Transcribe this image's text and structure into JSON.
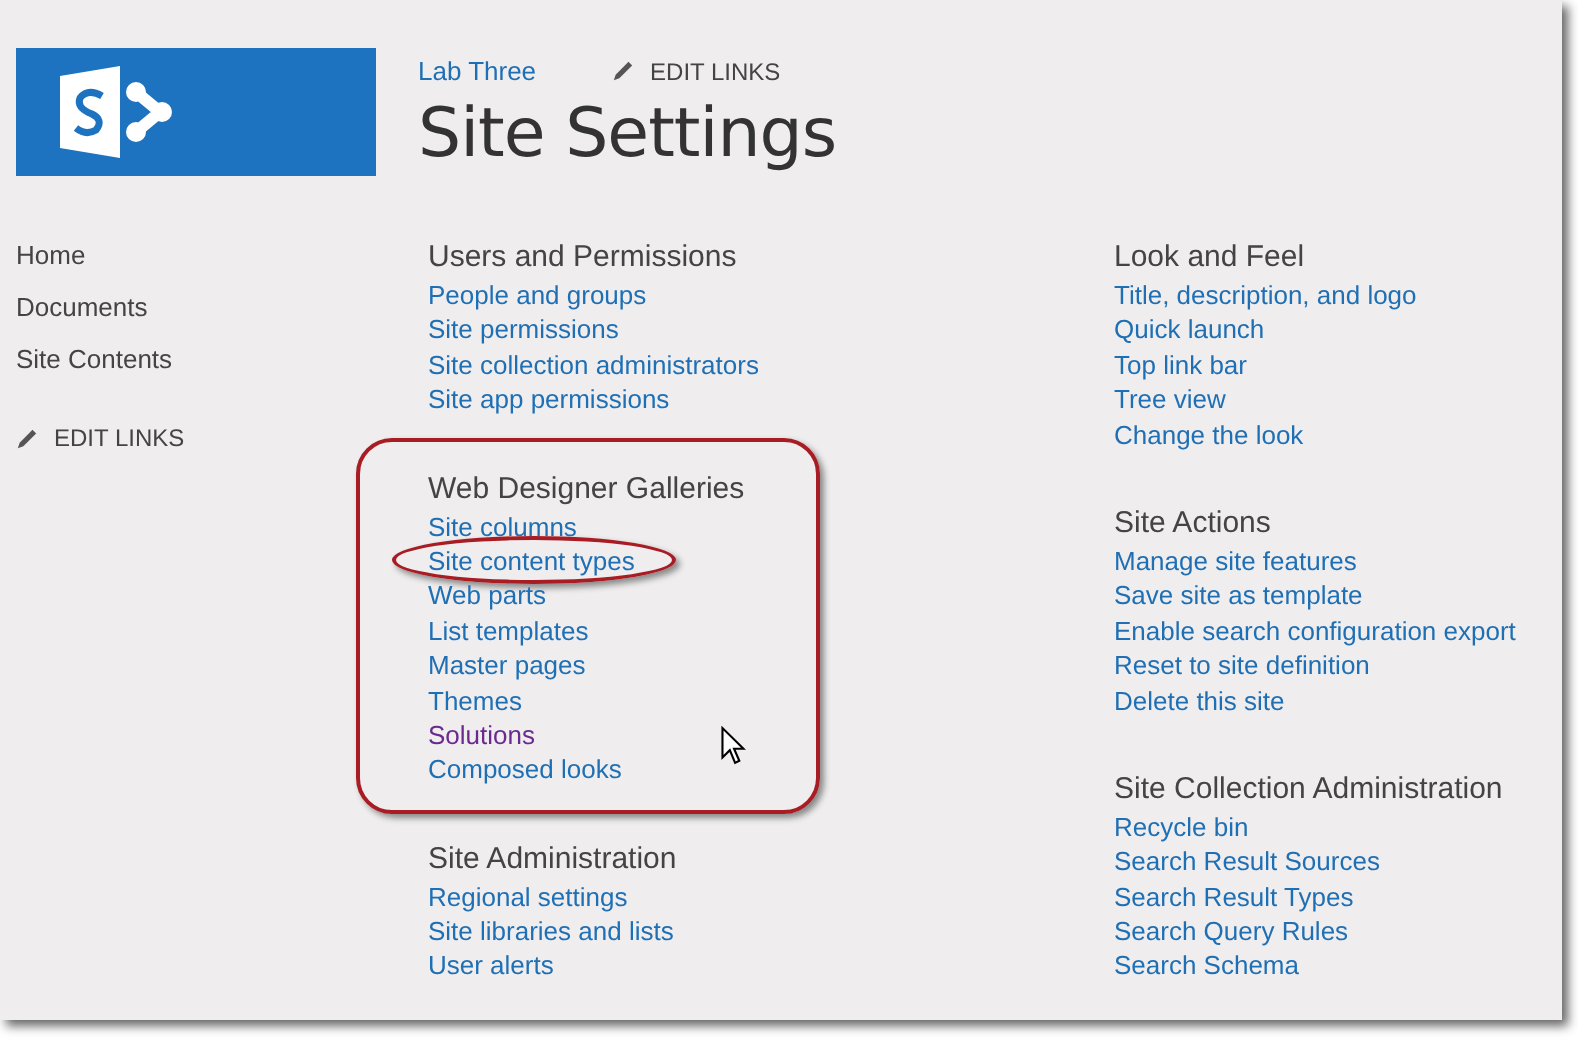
{
  "header": {
    "breadcrumb": "Lab Three",
    "edit_links": "EDIT LINKS",
    "title": "Site Settings"
  },
  "nav": {
    "items": [
      "Home",
      "Documents",
      "Site Contents"
    ],
    "edit_links": "EDIT LINKS"
  },
  "columns": [
    {
      "sections": [
        {
          "heading": "Users and Permissions",
          "circled": false,
          "links": [
            {
              "label": "People and groups",
              "visited": false,
              "circled": false
            },
            {
              "label": "Site permissions",
              "visited": false,
              "circled": false
            },
            {
              "label": "Site collection administrators",
              "visited": false,
              "circled": false
            },
            {
              "label": "Site app permissions",
              "visited": false,
              "circled": false
            }
          ]
        },
        {
          "heading": "Web Designer Galleries",
          "circled": true,
          "links": [
            {
              "label": "Site columns",
              "visited": false,
              "circled": false
            },
            {
              "label": "Site content types",
              "visited": false,
              "circled": true
            },
            {
              "label": "Web parts",
              "visited": false,
              "circled": false
            },
            {
              "label": "List templates",
              "visited": false,
              "circled": false
            },
            {
              "label": "Master pages",
              "visited": false,
              "circled": false
            },
            {
              "label": "Themes",
              "visited": false,
              "circled": false
            },
            {
              "label": "Solutions",
              "visited": true,
              "circled": false
            },
            {
              "label": "Composed looks",
              "visited": false,
              "circled": false
            }
          ]
        },
        {
          "heading": "Site Administration",
          "circled": false,
          "links": [
            {
              "label": "Regional settings",
              "visited": false,
              "circled": false
            },
            {
              "label": "Site libraries and lists",
              "visited": false,
              "circled": false
            },
            {
              "label": "User alerts",
              "visited": false,
              "circled": false
            }
          ]
        }
      ]
    },
    {
      "sections": [
        {
          "heading": "Look and Feel",
          "circled": false,
          "links": [
            {
              "label": "Title, description, and logo",
              "visited": false,
              "circled": false
            },
            {
              "label": "Quick launch",
              "visited": false,
              "circled": false
            },
            {
              "label": "Top link bar",
              "visited": false,
              "circled": false
            },
            {
              "label": "Tree view",
              "visited": false,
              "circled": false
            },
            {
              "label": "Change the look",
              "visited": false,
              "circled": false
            }
          ]
        },
        {
          "heading": "Site Actions",
          "circled": false,
          "links": [
            {
              "label": "Manage site features",
              "visited": false,
              "circled": false
            },
            {
              "label": "Save site as template",
              "visited": false,
              "circled": false
            },
            {
              "label": "Enable search configuration export",
              "visited": false,
              "circled": false
            },
            {
              "label": "Reset to site definition",
              "visited": false,
              "circled": false
            },
            {
              "label": "Delete this site",
              "visited": false,
              "circled": false
            }
          ]
        },
        {
          "heading": "Site Collection Administration",
          "circled": false,
          "links": [
            {
              "label": "Recycle bin",
              "visited": false,
              "circled": false
            },
            {
              "label": "Search Result Sources",
              "visited": false,
              "circled": false
            },
            {
              "label": "Search Result Types",
              "visited": false,
              "circled": false
            },
            {
              "label": "Search Query Rules",
              "visited": false,
              "circled": false
            },
            {
              "label": "Search Schema",
              "visited": false,
              "circled": false
            }
          ]
        }
      ]
    }
  ]
}
